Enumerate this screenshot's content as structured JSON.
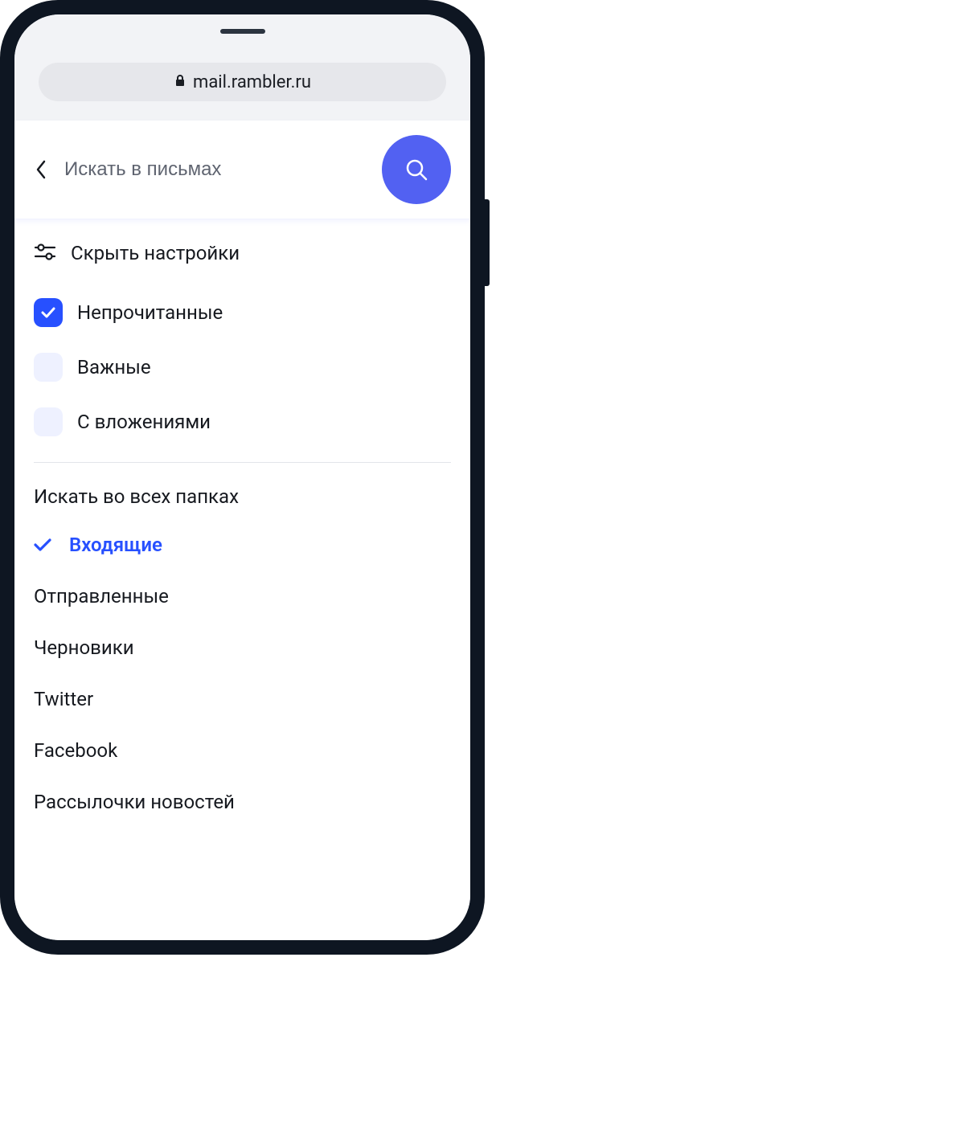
{
  "address_bar": {
    "url": "mail.rambler.ru"
  },
  "search": {
    "placeholder": "Искать в письмах",
    "value": ""
  },
  "settings_toggle": {
    "label": "Скрыть настройки"
  },
  "filters": [
    {
      "label": "Непрочитанные",
      "checked": true
    },
    {
      "label": "Важные",
      "checked": false
    },
    {
      "label": "С вложениями",
      "checked": false
    }
  ],
  "folders": {
    "header": "Искать во всех папках",
    "items": [
      {
        "label": "Входящие",
        "selected": true
      },
      {
        "label": "Отправленные",
        "selected": false
      },
      {
        "label": "Черновики",
        "selected": false
      },
      {
        "label": "Twitter",
        "selected": false
      },
      {
        "label": "Facebook",
        "selected": false
      },
      {
        "label": "Рассылочки новостей",
        "selected": false
      }
    ]
  },
  "colors": {
    "accent": "#2750ff",
    "search_button": "#5261f2"
  }
}
